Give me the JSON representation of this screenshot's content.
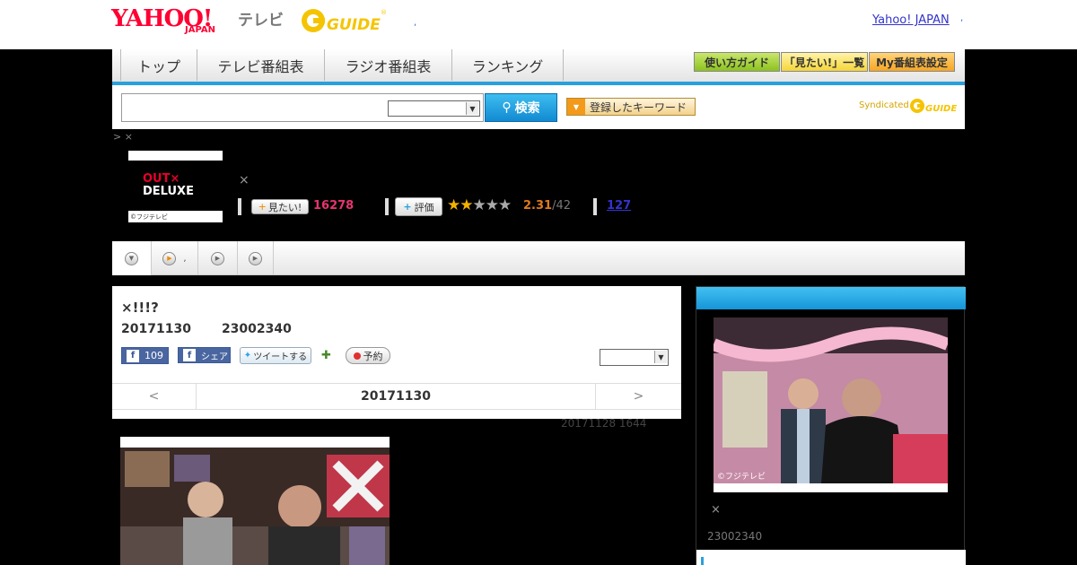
{
  "header": {
    "yahoo_logo": "YAHOO!",
    "yahoo_sub": "JAPAN",
    "tv_label": "テレビ",
    "gguide_logo": "G-GUIDE",
    "dot_mark": ",",
    "yahoo_japan_link": "Yahoo! JAPAN",
    "trailing_dot": ","
  },
  "nav": {
    "tabs": [
      "トップ",
      "テレビ番組表",
      "ラジオ番組表",
      "ランキング"
    ],
    "guide_button": "使い方ガイド",
    "mitai_list_button": "「見たい!」一覧",
    "my_schedule_button": "My番組表設定"
  },
  "search": {
    "input_value": "",
    "select_value": "",
    "search_button": "検索",
    "keyword_button": "登録したキーワード",
    "syndicated_label": "Syndicated"
  },
  "breadcrumb": "> ×",
  "program": {
    "thumb_title_line1": "OUT×",
    "thumb_title_line2": "DELUXE",
    "thumb_credit": "©フジテレビ",
    "cross": "×",
    "mitai_button": "見たい!",
    "mitai_count": "16278",
    "hyoka_button": "評価",
    "rating_value": 2.31,
    "rating_text": "2.31",
    "rating_count_text": "/42",
    "comment_count": "127"
  },
  "tabs_bar": {
    "dot_label": ","
  },
  "main": {
    "title": "×!!!?",
    "date": "20171130",
    "time": "23002340",
    "fb_like_count": "109",
    "fb_share_label": "シェア",
    "tweet_label": "ツイートする",
    "reserve_label": "予約",
    "select_value": "",
    "pager_prev": "<",
    "pager_date": "20171130",
    "pager_next": ">"
  },
  "update_line": "20171128  1644",
  "sidebar": {
    "photo_credit": "©フジテレビ",
    "cross": "×",
    "time": "23002340"
  }
}
